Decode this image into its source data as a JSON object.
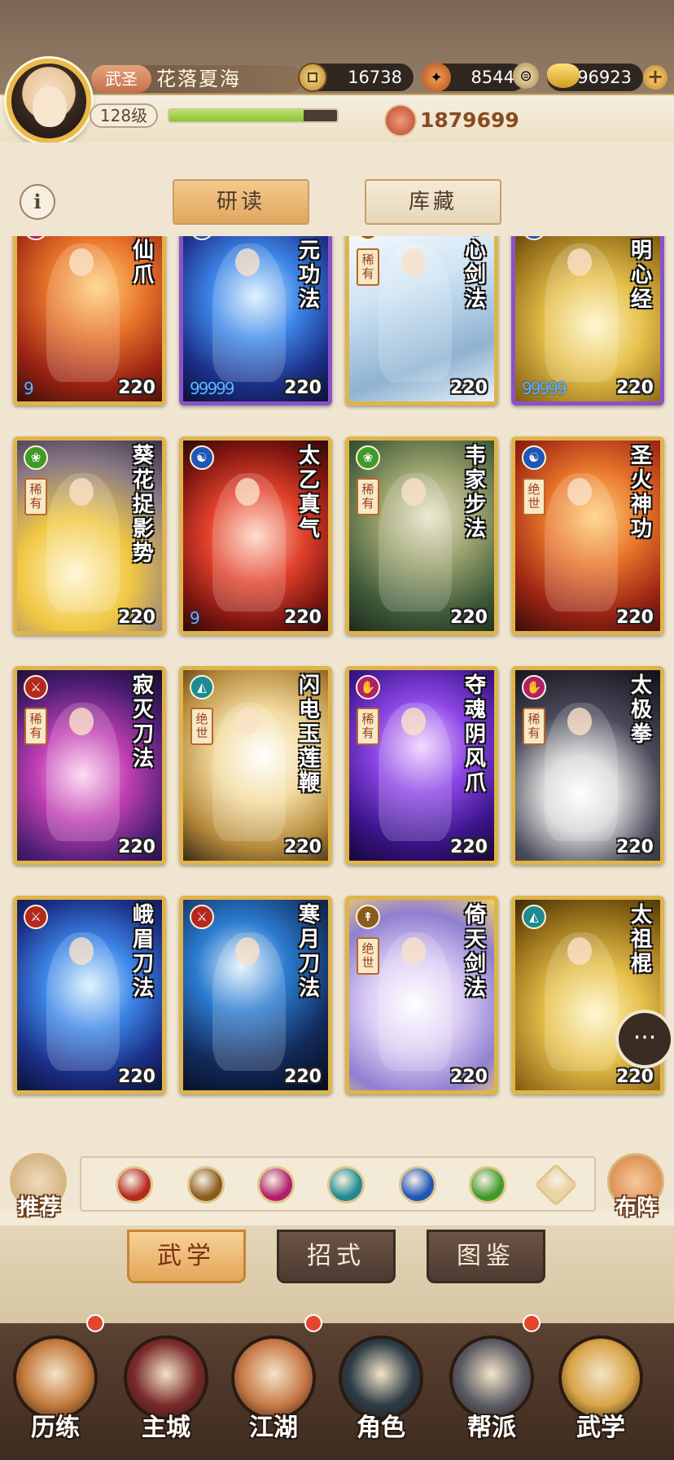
{
  "player": {
    "title": "武圣",
    "name": "花落夏海",
    "level": "128级",
    "exp_fraction": 0.8,
    "power": "1879699"
  },
  "resources": {
    "coins": "16738",
    "leaves": "8544",
    "ingots": "96923",
    "plus": "+"
  },
  "sub_tabs": {
    "info": "i",
    "study": "研读",
    "collection": "库藏"
  },
  "cards": [
    {
      "name": "灭仙爪",
      "level": "220",
      "rarity": "",
      "stars": "9",
      "school": "fist",
      "theme": "fire",
      "frame": "gold"
    },
    {
      "name": "混元功法",
      "level": "220",
      "rarity": "",
      "stars": "99999",
      "school": "taiji",
      "theme": "blue",
      "frame": "purple"
    },
    {
      "name": "冰心剑法",
      "level": "220",
      "rarity": "稀有",
      "stars": "",
      "school": "sword",
      "theme": "ice",
      "frame": "gold"
    },
    {
      "name": "玉明心经",
      "level": "220",
      "rarity": "",
      "stars": "99999",
      "school": "taiji",
      "theme": "goldlight",
      "frame": "purple"
    },
    {
      "name": "葵花捉影势",
      "level": "220",
      "rarity": "稀有",
      "stars": "",
      "school": "leaf",
      "theme": "gold",
      "frame": "gold"
    },
    {
      "name": "太乙真气",
      "level": "220",
      "rarity": "",
      "stars": "9",
      "school": "taiji",
      "theme": "red",
      "frame": "gold"
    },
    {
      "name": "韦家步法",
      "level": "220",
      "rarity": "稀有",
      "stars": "",
      "school": "leaf",
      "theme": "earth",
      "frame": "gold"
    },
    {
      "name": "圣火神功",
      "level": "220",
      "rarity": "绝世",
      "stars": "",
      "school": "taiji",
      "theme": "fire",
      "frame": "gold"
    },
    {
      "name": "寂灭刀法",
      "level": "220",
      "rarity": "稀有",
      "stars": "",
      "school": "blade",
      "theme": "violet",
      "frame": "gold"
    },
    {
      "name": "闪电玉莲鞭",
      "level": "220",
      "rarity": "绝世",
      "stars": "",
      "school": "fan",
      "theme": "bright",
      "frame": "gold"
    },
    {
      "name": "夺魂阴风爪",
      "level": "220",
      "rarity": "稀有",
      "stars": "",
      "school": "fist",
      "theme": "purple",
      "frame": "gold"
    },
    {
      "name": "太极拳",
      "level": "220",
      "rarity": "稀有",
      "stars": "",
      "school": "fist",
      "theme": "dark",
      "frame": "gold"
    },
    {
      "name": "峨眉刀法",
      "level": "220",
      "rarity": "",
      "stars": "",
      "school": "blade",
      "theme": "blue",
      "frame": "gold"
    },
    {
      "name": "寒月刀法",
      "level": "220",
      "rarity": "",
      "stars": "",
      "school": "blade",
      "theme": "night",
      "frame": "gold"
    },
    {
      "name": "倚天剑法",
      "level": "220",
      "rarity": "绝世",
      "stars": "",
      "school": "sword",
      "theme": "lavender",
      "frame": "gold"
    },
    {
      "name": "太祖棍",
      "level": "220",
      "rarity": "",
      "stars": "",
      "school": "fan",
      "theme": "goldlight",
      "frame": "gold"
    }
  ],
  "filters": {
    "recommend": "推荐",
    "formation": "布阵",
    "schools": [
      {
        "icon": "blade-icon",
        "color": "#b5281e"
      },
      {
        "icon": "sword-icon",
        "color": "#8a5a1e"
      },
      {
        "icon": "fist-icon",
        "color": "#b0206a"
      },
      {
        "icon": "fan-icon",
        "color": "#1f8a92"
      },
      {
        "icon": "taiji-icon",
        "color": "#1f56b8"
      },
      {
        "icon": "leaf-icon",
        "color": "#3f9a2a"
      },
      {
        "icon": "other-icon",
        "color": "#e9d3a4"
      }
    ]
  },
  "category_tabs": [
    "武学",
    "招式",
    "图鉴"
  ],
  "nav": [
    {
      "label": "历练",
      "badge": true
    },
    {
      "label": "主城",
      "badge": false
    },
    {
      "label": "江湖",
      "badge": true
    },
    {
      "label": "角色",
      "badge": false
    },
    {
      "label": "帮派",
      "badge": true
    },
    {
      "label": "武学",
      "badge": false
    }
  ],
  "chat_icon": "···",
  "colors": {
    "accent_gold": "#e0b449",
    "accent_purple": "#8a52c8",
    "active_tab": "#e2a65f",
    "notification": "#e6452d"
  }
}
